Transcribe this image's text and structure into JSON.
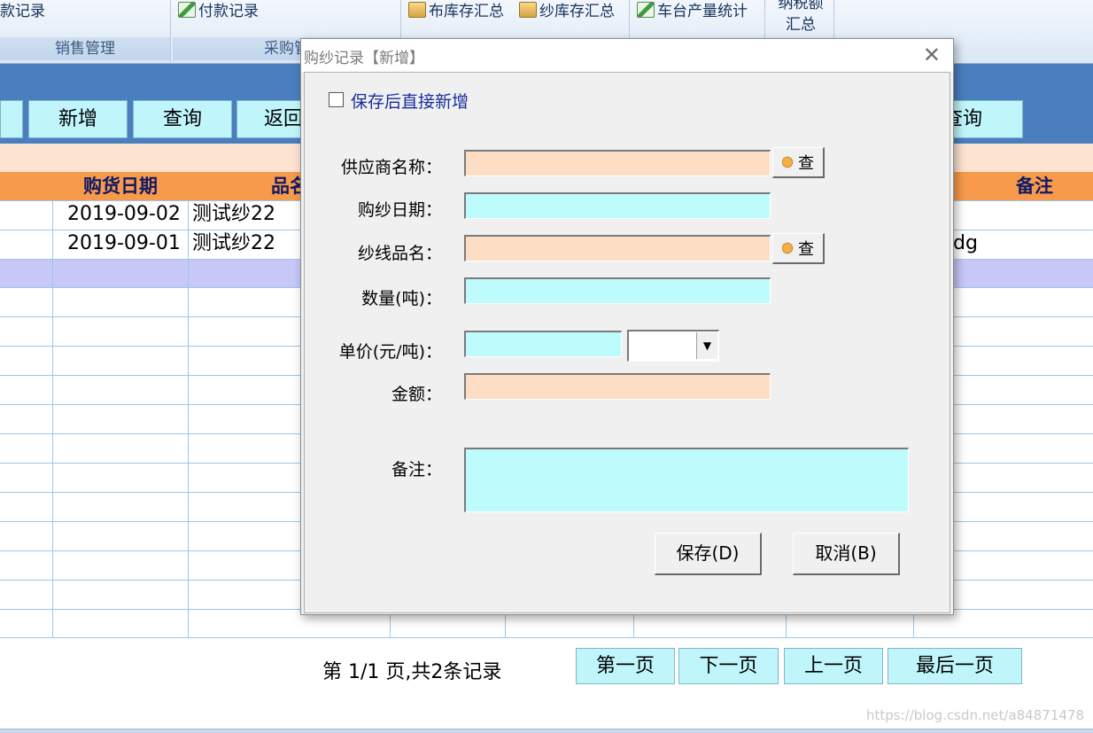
{
  "ribbon": {
    "groups": [
      {
        "label": "销售管理",
        "buttons": [
          "款记录"
        ]
      },
      {
        "label": "采购管",
        "buttons": [
          "付款记录"
        ]
      },
      {
        "label": "",
        "buttons": [
          "布库存汇总",
          "纱库存汇总"
        ]
      },
      {
        "label": "",
        "buttons": [
          "车台产量统计"
        ]
      },
      {
        "label": "",
        "buttons": [
          "纳税额",
          "汇总"
        ]
      }
    ]
  },
  "toolbar": {
    "new_label": "新增",
    "query_label": "查询",
    "back_label": "返回",
    "query2_label": "查询"
  },
  "table": {
    "headers": [
      "购货日期",
      "品名",
      "备注"
    ],
    "rows": [
      {
        "date": "2019-09-02",
        "name": "测试纱22",
        "remark": ""
      },
      {
        "date": "2019-09-01",
        "name": "测试纱22",
        "remark": "dg"
      }
    ]
  },
  "pager": {
    "info": "第 1/1 页,共2条记录",
    "first": "第一页",
    "next": "下一页",
    "prev": "上一页",
    "last": "最后一页"
  },
  "dialog": {
    "title": "购纱记录【新增】",
    "close_glyph": "✕",
    "checkbox_label": "保存后直接新增",
    "fields": {
      "supplier": {
        "label": "供应商名称：",
        "value": ""
      },
      "date": {
        "label": "购纱日期：",
        "value": ""
      },
      "yarn": {
        "label": "纱线品名：",
        "value": ""
      },
      "qty": {
        "label": "数量(吨)：",
        "value": ""
      },
      "price": {
        "label": "单价(元/吨)：",
        "value": ""
      },
      "amount": {
        "label": "金额：",
        "value": ""
      },
      "remark": {
        "label": "备注：",
        "value": ""
      }
    },
    "lookup_label": "查",
    "save_label": "保存(D)",
    "cancel_label": "取消(B)"
  },
  "watermark": "https://blog.csdn.net/a84871478",
  "colors": {
    "accent_blue": "#4a7fbf",
    "header_orange": "#f79a4c",
    "button_cyan": "#c0f6fb",
    "field_peach": "#fddec4",
    "field_cyan": "#bdfbfd"
  },
  "icons": [
    "doc-check-icon",
    "box-icon",
    "hand-pointer-icon",
    "chevron-down-icon",
    "close-icon"
  ]
}
